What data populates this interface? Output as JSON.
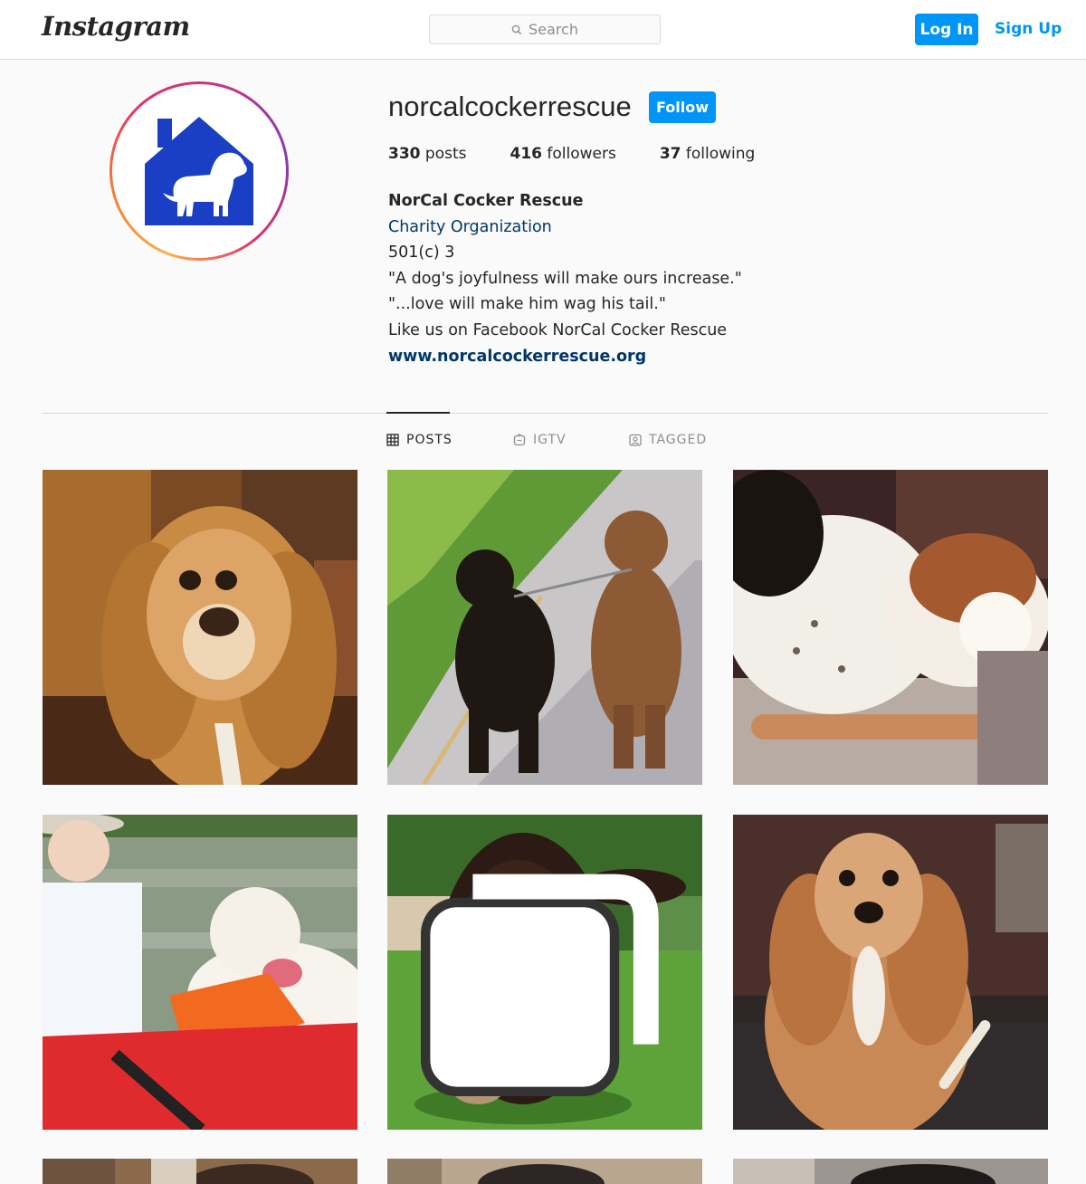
{
  "header": {
    "logo": "Instagram",
    "search_placeholder": "Search",
    "login_label": "Log In",
    "signup_label": "Sign Up"
  },
  "profile": {
    "username": "norcalcockerrescue",
    "follow_label": "Follow",
    "stats": [
      {
        "count": "330",
        "label": "posts"
      },
      {
        "count": "416",
        "label": "followers"
      },
      {
        "count": "37",
        "label": "following"
      }
    ],
    "bio": {
      "name": "NorCal Cocker Rescue",
      "category": "Charity Organization",
      "lines": [
        "501(c) 3",
        "\"A dog's joyfulness will make ours increase.\"",
        "\"...love will make him wag his tail.\"",
        "Like us on Facebook NorCal Cocker Rescue"
      ],
      "website": "www.norcalcockerrescue.org"
    }
  },
  "tabs": [
    {
      "label": "POSTS",
      "icon": "grid-icon",
      "active": true
    },
    {
      "label": "IGTV",
      "icon": "igtv-icon",
      "active": false
    },
    {
      "label": "TAGGED",
      "icon": "tagged-icon",
      "active": false
    }
  ],
  "posts": [
    {
      "subject": "golden cocker spaniel portrait",
      "carousel": false
    },
    {
      "subject": "two dogs walking on leash",
      "carousel": false
    },
    {
      "subject": "sleeping tricolor dog",
      "carousel": false
    },
    {
      "subject": "woman and dog in kayak",
      "carousel": false
    },
    {
      "subject": "dark cocker spaniel on lawn",
      "carousel": true
    },
    {
      "subject": "curly red cocker spaniel with bone",
      "carousel": false
    }
  ],
  "colors": {
    "accent": "#0095f6",
    "link": "#00376b",
    "border": "#dbdbdb",
    "background": "#fafafa",
    "logo_blue": "#1a3fc4"
  }
}
